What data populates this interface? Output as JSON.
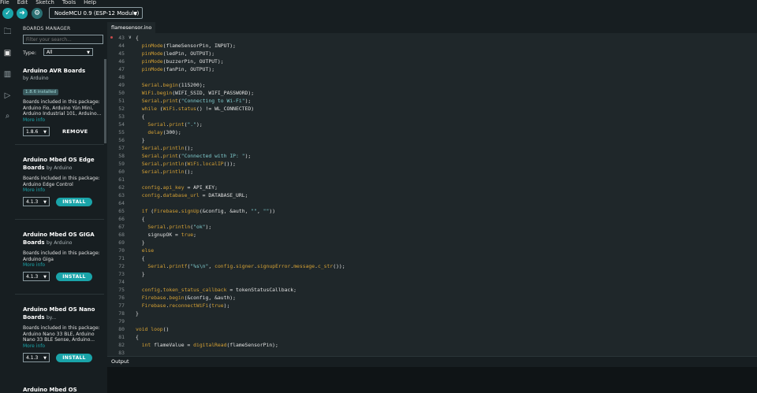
{
  "menu": [
    "File",
    "Edit",
    "Sketch",
    "Tools",
    "Help"
  ],
  "toolbar": {
    "verify_icon": "check-icon",
    "upload_icon": "arrow-right-icon",
    "debug_icon": "debug-icon",
    "board": "NodeMCU 0.9 (ESP-12 Module)"
  },
  "activity": [
    "folder-icon",
    "boards-manager-icon",
    "library-icon",
    "debug-icon",
    "search-icon"
  ],
  "boards_manager": {
    "title": "BOARDS MANAGER",
    "filter_placeholder": "Filter your search...",
    "type_label": "Type:",
    "type_value": "All",
    "cards": [
      {
        "name": "Arduino AVR Boards",
        "by": "",
        "author": "by Arduino",
        "installed": "1.8.6 installed",
        "desc": "Boards included in this package: Arduino Fio, Arduino Yún Mini, Arduino Industrial 101, Arduino...",
        "more": "More info",
        "version": "1.8.6",
        "action": "REMOVE"
      },
      {
        "name": "Arduino Mbed OS Edge Boards",
        "by": "by Arduino",
        "author": "",
        "installed": "",
        "desc": "Boards included in this package: Arduino Edge Control",
        "more": "More info",
        "version": "4.1.3",
        "action": "INSTALL"
      },
      {
        "name": "Arduino Mbed OS GIGA Boards",
        "by": "by Arduino",
        "author": "",
        "installed": "",
        "desc": "Boards included in this package: Arduino Giga",
        "more": "More info",
        "version": "4.1.3",
        "action": "INSTALL"
      },
      {
        "name": "Arduino Mbed OS Nano Boards",
        "by": "by...",
        "author": "",
        "installed": "",
        "desc": "Boards included in this package: Arduino Nano 33 BLE, Arduino Nano 33 BLE Sense, Arduino...",
        "more": "More info",
        "version": "4.1.3",
        "action": "INSTALL"
      },
      {
        "name": "Arduino Mbed OS",
        "by": "",
        "author": "",
        "installed": "",
        "desc": "",
        "more": "",
        "version": "",
        "action": ""
      }
    ]
  },
  "editor": {
    "file_tab": "flamesensor.ino",
    "lines": [
      {
        "n": "43",
        "fold": "∨",
        "code": [
          [
            "p",
            "{"
          ]
        ]
      },
      {
        "n": "44",
        "code": [
          [
            "p",
            "  "
          ],
          [
            "f",
            "pinMode"
          ],
          [
            "p",
            "(flameSensorPin, INPUT);"
          ]
        ]
      },
      {
        "n": "45",
        "code": [
          [
            "p",
            "  "
          ],
          [
            "f",
            "pinMode"
          ],
          [
            "p",
            "(ledPin, OUTPUT);"
          ]
        ]
      },
      {
        "n": "46",
        "code": [
          [
            "p",
            "  "
          ],
          [
            "f",
            "pinMode"
          ],
          [
            "p",
            "(buzzerPin, OUTPUT);"
          ]
        ]
      },
      {
        "n": "47",
        "code": [
          [
            "p",
            "  "
          ],
          [
            "f",
            "pinMode"
          ],
          [
            "p",
            "(fanPin, OUTPUT);"
          ]
        ]
      },
      {
        "n": "48",
        "code": []
      },
      {
        "n": "49",
        "code": [
          [
            "p",
            "  "
          ],
          [
            "f",
            "Serial"
          ],
          [
            "p",
            "."
          ],
          [
            "f",
            "begin"
          ],
          [
            "p",
            "(115200);"
          ]
        ]
      },
      {
        "n": "50",
        "code": [
          [
            "p",
            "  "
          ],
          [
            "f",
            "WiFi"
          ],
          [
            "p",
            "."
          ],
          [
            "f",
            "begin"
          ],
          [
            "p",
            "(WIFI_SSID, WIFI_PASSWORD);"
          ]
        ]
      },
      {
        "n": "51",
        "code": [
          [
            "p",
            "  "
          ],
          [
            "f",
            "Serial"
          ],
          [
            "p",
            "."
          ],
          [
            "f",
            "print"
          ],
          [
            "p",
            "("
          ],
          [
            "s",
            "\"Connecting to Wi-Fi\""
          ],
          [
            "p",
            ");"
          ]
        ]
      },
      {
        "n": "52",
        "code": [
          [
            "p",
            "  "
          ],
          [
            "k",
            "while"
          ],
          [
            "p",
            " ("
          ],
          [
            "f",
            "WiFi"
          ],
          [
            "p",
            "."
          ],
          [
            "f",
            "status"
          ],
          [
            "p",
            "() != WL_CONNECTED)"
          ]
        ]
      },
      {
        "n": "53",
        "code": [
          [
            "p",
            "  {"
          ]
        ]
      },
      {
        "n": "54",
        "code": [
          [
            "p",
            "    "
          ],
          [
            "f",
            "Serial"
          ],
          [
            "p",
            "."
          ],
          [
            "f",
            "print"
          ],
          [
            "p",
            "("
          ],
          [
            "s",
            "\".\""
          ],
          [
            "p",
            ");"
          ]
        ]
      },
      {
        "n": "55",
        "code": [
          [
            "p",
            "    "
          ],
          [
            "f",
            "delay"
          ],
          [
            "p",
            "(300);"
          ]
        ]
      },
      {
        "n": "56",
        "code": [
          [
            "p",
            "  }"
          ]
        ]
      },
      {
        "n": "57",
        "code": [
          [
            "p",
            "  "
          ],
          [
            "f",
            "Serial"
          ],
          [
            "p",
            "."
          ],
          [
            "f",
            "println"
          ],
          [
            "p",
            "();"
          ]
        ]
      },
      {
        "n": "58",
        "code": [
          [
            "p",
            "  "
          ],
          [
            "f",
            "Serial"
          ],
          [
            "p",
            "."
          ],
          [
            "f",
            "print"
          ],
          [
            "p",
            "("
          ],
          [
            "s",
            "\"Connected with IP: \""
          ],
          [
            "p",
            ");"
          ]
        ]
      },
      {
        "n": "59",
        "code": [
          [
            "p",
            "  "
          ],
          [
            "f",
            "Serial"
          ],
          [
            "p",
            "."
          ],
          [
            "f",
            "println"
          ],
          [
            "p",
            "("
          ],
          [
            "f",
            "WiFi"
          ],
          [
            "p",
            "."
          ],
          [
            "f",
            "localIP"
          ],
          [
            "p",
            "());"
          ]
        ]
      },
      {
        "n": "60",
        "code": [
          [
            "p",
            "  "
          ],
          [
            "f",
            "Serial"
          ],
          [
            "p",
            "."
          ],
          [
            "f",
            "println"
          ],
          [
            "p",
            "();"
          ]
        ]
      },
      {
        "n": "61",
        "code": []
      },
      {
        "n": "62",
        "code": [
          [
            "p",
            "  "
          ],
          [
            "f",
            "config"
          ],
          [
            "p",
            "."
          ],
          [
            "f",
            "api_key"
          ],
          [
            "p",
            " = API_KEY;"
          ]
        ]
      },
      {
        "n": "63",
        "code": [
          [
            "p",
            "  "
          ],
          [
            "f",
            "config"
          ],
          [
            "p",
            "."
          ],
          [
            "f",
            "database_url"
          ],
          [
            "p",
            " = DATABASE_URL;"
          ]
        ]
      },
      {
        "n": "64",
        "code": []
      },
      {
        "n": "65",
        "code": [
          [
            "p",
            "  "
          ],
          [
            "k",
            "if"
          ],
          [
            "p",
            " ("
          ],
          [
            "f",
            "Firebase"
          ],
          [
            "p",
            "."
          ],
          [
            "f",
            "signUp"
          ],
          [
            "p",
            "(&config, &auth, "
          ],
          [
            "s",
            "\"\""
          ],
          [
            "p",
            ", "
          ],
          [
            "s",
            "\"\""
          ],
          [
            "p",
            "))"
          ]
        ]
      },
      {
        "n": "66",
        "code": [
          [
            "p",
            "  {"
          ]
        ]
      },
      {
        "n": "67",
        "code": [
          [
            "p",
            "    "
          ],
          [
            "f",
            "Serial"
          ],
          [
            "p",
            "."
          ],
          [
            "f",
            "println"
          ],
          [
            "p",
            "("
          ],
          [
            "s",
            "\"ok\""
          ],
          [
            "p",
            ");"
          ]
        ]
      },
      {
        "n": "68",
        "code": [
          [
            "p",
            "    signupOK = "
          ],
          [
            "k",
            "true"
          ],
          [
            "p",
            ";"
          ]
        ]
      },
      {
        "n": "69",
        "code": [
          [
            "p",
            "  }"
          ]
        ]
      },
      {
        "n": "70",
        "code": [
          [
            "p",
            "  "
          ],
          [
            "k",
            "else"
          ]
        ]
      },
      {
        "n": "71",
        "code": [
          [
            "p",
            "  {"
          ]
        ]
      },
      {
        "n": "72",
        "code": [
          [
            "p",
            "    "
          ],
          [
            "f",
            "Serial"
          ],
          [
            "p",
            "."
          ],
          [
            "f",
            "printf"
          ],
          [
            "p",
            "("
          ],
          [
            "s",
            "\"%s\\n\""
          ],
          [
            "p",
            ", "
          ],
          [
            "f",
            "config"
          ],
          [
            "p",
            "."
          ],
          [
            "f",
            "signer"
          ],
          [
            "p",
            "."
          ],
          [
            "f",
            "signupError"
          ],
          [
            "p",
            "."
          ],
          [
            "f",
            "message"
          ],
          [
            "p",
            "."
          ],
          [
            "f",
            "c_str"
          ],
          [
            "p",
            "());"
          ]
        ]
      },
      {
        "n": "73",
        "code": [
          [
            "p",
            "  }"
          ]
        ]
      },
      {
        "n": "74",
        "code": []
      },
      {
        "n": "75",
        "code": [
          [
            "p",
            "  "
          ],
          [
            "f",
            "config"
          ],
          [
            "p",
            "."
          ],
          [
            "f",
            "token_status_callback"
          ],
          [
            "p",
            " = tokenStatusCallback;"
          ]
        ]
      },
      {
        "n": "76",
        "code": [
          [
            "p",
            "  "
          ],
          [
            "f",
            "Firebase"
          ],
          [
            "p",
            "."
          ],
          [
            "f",
            "begin"
          ],
          [
            "p",
            "(&config, &auth);"
          ]
        ]
      },
      {
        "n": "77",
        "code": [
          [
            "p",
            "  "
          ],
          [
            "f",
            "Firebase"
          ],
          [
            "p",
            "."
          ],
          [
            "f",
            "reconnectWiFi"
          ],
          [
            "p",
            "("
          ],
          [
            "k",
            "true"
          ],
          [
            "p",
            ");"
          ]
        ]
      },
      {
        "n": "78",
        "code": [
          [
            "p",
            "}"
          ]
        ]
      },
      {
        "n": "79",
        "code": []
      },
      {
        "n": "80",
        "code": [
          [
            "k",
            "void"
          ],
          [
            "p",
            " "
          ],
          [
            "f",
            "loop"
          ],
          [
            "p",
            "()"
          ]
        ]
      },
      {
        "n": "81",
        "code": [
          [
            "p",
            "{"
          ]
        ]
      },
      {
        "n": "82",
        "code": [
          [
            "p",
            "  "
          ],
          [
            "k",
            "int"
          ],
          [
            "p",
            " flameValue = "
          ],
          [
            "f",
            "digitalRead"
          ],
          [
            "p",
            "(flameSensorPin);"
          ]
        ]
      },
      {
        "n": "83",
        "code": []
      }
    ]
  },
  "output": {
    "label": "Output"
  }
}
